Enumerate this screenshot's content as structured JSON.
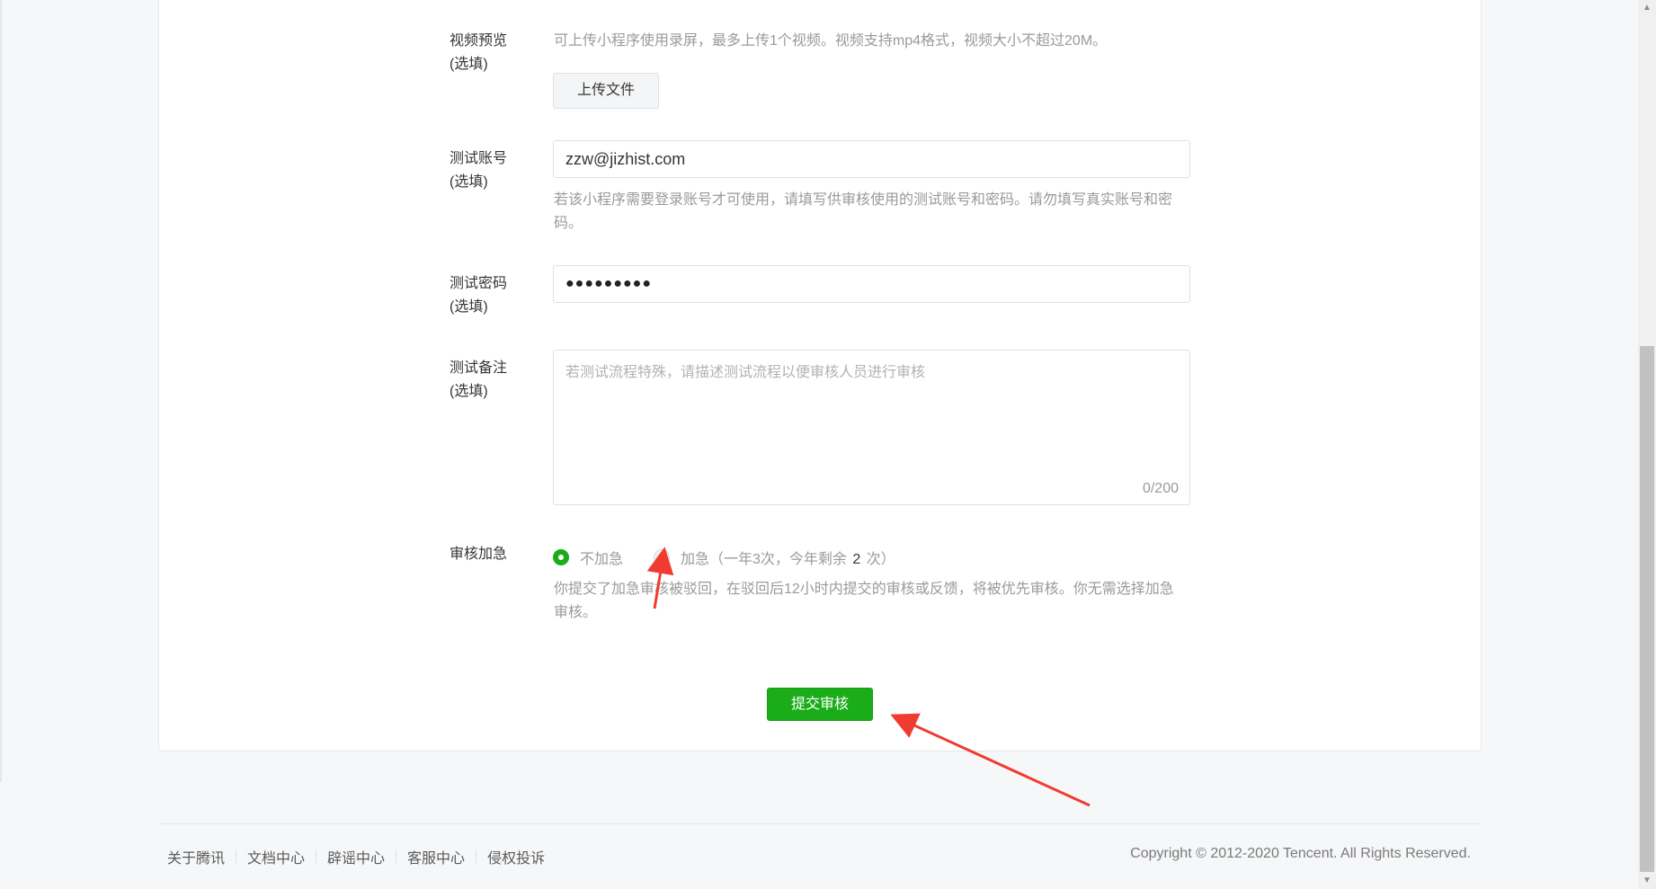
{
  "form": {
    "video_preview": {
      "label": "视频预览",
      "optional": "(选填)",
      "hint": "可上传小程序使用录屏，最多上传1个视频。视频支持mp4格式，视频大小不超过20M。",
      "upload_button": "上传文件"
    },
    "test_account": {
      "label": "测试账号",
      "optional": "(选填)",
      "value": "zzw@jizhist.com",
      "hint": "若该小程序需要登录账号才可使用，请填写供审核使用的测试账号和密码。请勿填写真实账号和密码。"
    },
    "test_password": {
      "label": "测试密码",
      "optional": "(选填)",
      "value": "●●●●●●●●●"
    },
    "test_notes": {
      "label": "测试备注",
      "optional": "(选填)",
      "placeholder": "若测试流程特殊，请描述测试流程以便审核人员进行审核",
      "counter": "0/200"
    },
    "expedite": {
      "label": "审核加急",
      "option_no": "不加急",
      "option_yes_prefix": "加急（一年3次，今年剩余",
      "remaining": "2",
      "option_yes_suffix": "次）",
      "hint": "你提交了加急审核被驳回，在驳回后12小时内提交的审核或反馈，将被优先审核。你无需选择加急审核。"
    },
    "submit_button": "提交审核"
  },
  "footer": {
    "links": [
      "关于腾讯",
      "文档中心",
      "辟谣中心",
      "客服中心",
      "侵权投诉"
    ],
    "copyright": "Copyright © 2012-2020 Tencent. All Rights Reserved."
  },
  "colors": {
    "accent_green": "#1aad19",
    "annotation_red": "#f03c30"
  }
}
